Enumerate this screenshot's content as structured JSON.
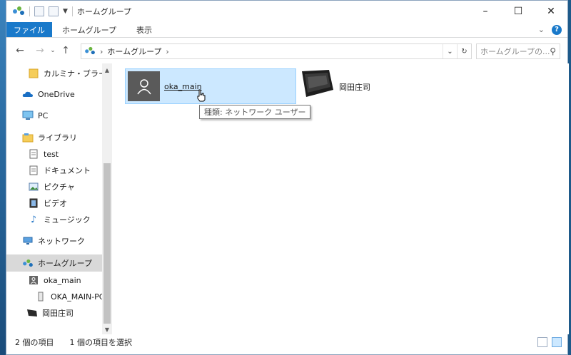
{
  "title": "ホームグループ",
  "ribbon": {
    "file": "ファイル",
    "tabs": [
      "ホームグループ",
      "表示"
    ]
  },
  "address": {
    "path": [
      "ホームグループ"
    ],
    "search_placeholder": "ホームグループの..."
  },
  "nav": {
    "items": [
      {
        "label": "カルミナ・ブラーナ",
        "icon": "folder-icon"
      },
      {
        "label": "OneDrive",
        "icon": "onedrive-icon"
      },
      {
        "label": "PC",
        "icon": "pc-icon"
      },
      {
        "label": "ライブラリ",
        "icon": "library-icon"
      },
      {
        "label": "test",
        "icon": "document-icon"
      },
      {
        "label": "ドキュメント",
        "icon": "document-icon"
      },
      {
        "label": "ピクチャ",
        "icon": "picture-icon"
      },
      {
        "label": "ビデオ",
        "icon": "video-icon"
      },
      {
        "label": "ミュージック",
        "icon": "music-icon"
      },
      {
        "label": "ネットワーク",
        "icon": "network-icon"
      },
      {
        "label": "ホームグループ",
        "icon": "homegroup-icon"
      },
      {
        "label": "oka_main",
        "icon": "user-icon"
      },
      {
        "label": "OKA_MAIN-PC",
        "icon": "drive-icon"
      },
      {
        "label": "岡田庄司",
        "icon": "laptop-icon"
      }
    ]
  },
  "content": {
    "items": [
      {
        "name": "oka_main",
        "selected": true
      },
      {
        "name": "岡田庄司",
        "selected": false
      }
    ],
    "tooltip": "種類: ネットワーク ユーザー"
  },
  "status": {
    "count": "2 個の項目",
    "selected": "1 個の項目を選択"
  },
  "colors": {
    "accent": "#1979ca",
    "selection": "#cce8ff",
    "selection_border": "#99d1ff"
  }
}
